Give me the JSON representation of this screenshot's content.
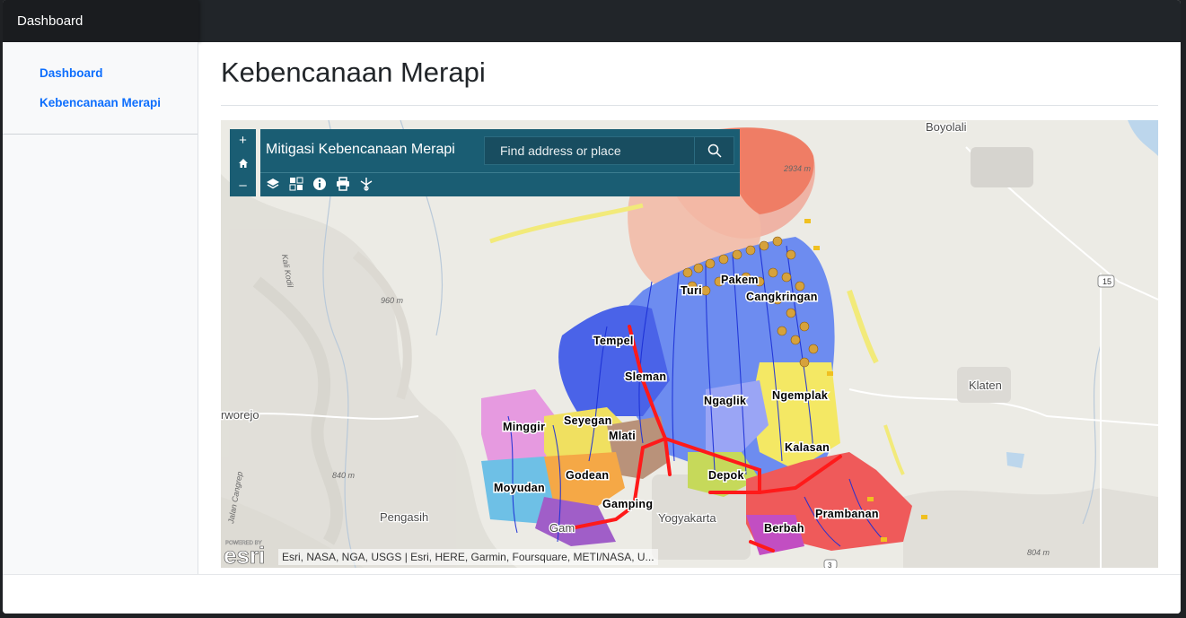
{
  "navbar": {
    "brand": "Dashboard"
  },
  "sidebar": {
    "items": [
      {
        "label": "Dashboard"
      },
      {
        "label": "Kebencanaan Merapi"
      }
    ]
  },
  "page": {
    "title": "Kebencanaan Merapi"
  },
  "map": {
    "app_title": "Mitigasi Kebencanaan Merapi",
    "search": {
      "placeholder": "Find address or place"
    },
    "zoom": {
      "in": "+",
      "home": "home-icon",
      "out": "–"
    },
    "tools": [
      "layers-icon",
      "basemap-gallery-icon",
      "info-icon",
      "print-icon",
      "measure-icon"
    ],
    "attribution": "Esri, NASA, NGA, USGS | Esri, HERE, Garmin, Foursquare, METI/NASA, U...",
    "logo": {
      "text": "esri",
      "powered_by": "POWERED BY"
    },
    "basemap_labels": {
      "boyolali": "Boyolali",
      "klaten": "Klaten",
      "yogyakarta": "Yogyakarta",
      "pengasih": "Pengasih",
      "purworejo": "rworejo",
      "gamping_edge": "Gam",
      "elev_960": "960 m",
      "elev_840": "840 m",
      "elev_804": "804 m",
      "elev_2934": "2934 m",
      "kali_kodil": "Kali Kodil",
      "road_15": "15",
      "road_3": "3",
      "jalan_cangrep": "Jalan Cangrep"
    },
    "district_labels": {
      "turi": "Turi",
      "pakem": "Pakem",
      "cangkringan": "Cangkringan",
      "tempel": "Tempel",
      "sleman": "Sleman",
      "ngaglik": "Ngaglik",
      "ngemplak": "Ngemplak",
      "minggir": "Minggir",
      "seyegan": "Seyegan",
      "mlati": "Mlati",
      "kalasan": "Kalasan",
      "godean": "Godean",
      "depok": "Depok",
      "moyudan": "Moyudan",
      "gamping": "Gamping",
      "prambanan": "Prambanan",
      "berbah": "Berbah"
    },
    "colors": {
      "panel": "#1a5d73",
      "danger_zone": "#f26b4a",
      "road": "#ff1a1a"
    }
  }
}
